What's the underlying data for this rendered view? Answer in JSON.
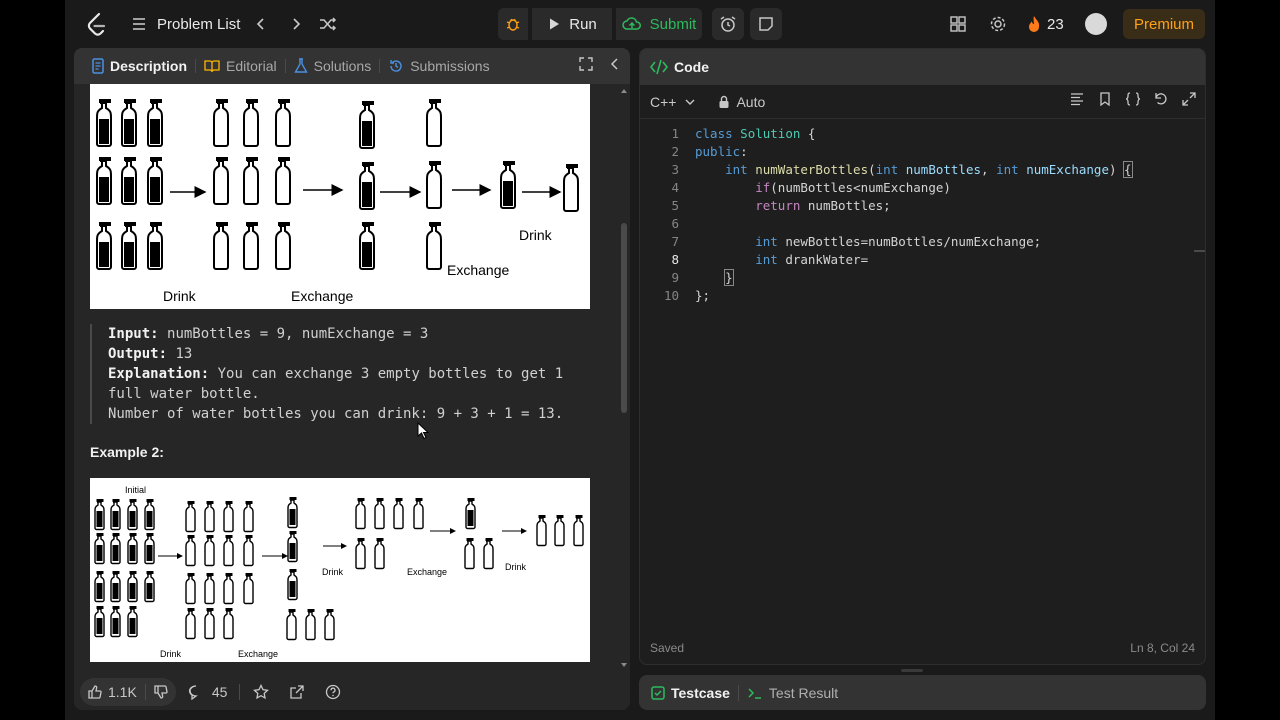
{
  "nav": {
    "problem_list": "Problem List",
    "run": "Run",
    "submit": "Submit",
    "streak": "23",
    "premium": "Premium"
  },
  "tabs": [
    {
      "label": "Description",
      "icon": "description-icon"
    },
    {
      "label": "Editorial",
      "icon": "book-icon"
    },
    {
      "label": "Solutions",
      "icon": "flask-icon"
    },
    {
      "label": "Submissions",
      "icon": "history-icon"
    }
  ],
  "example1": {
    "image_labels": {
      "drink": "Drink",
      "exchange": "Exchange",
      "drink2": "Drink",
      "exchange2": "Exchange"
    },
    "input_label": "Input:",
    "input_value": "numBottles = 9, numExchange = 3",
    "output_label": "Output:",
    "output_value": "13",
    "explanation_label": "Explanation:",
    "explanation_line1": "You can exchange 3 empty bottles to get 1",
    "explanation_line2": "full water bottle.",
    "explanation_line3": "Number of water bottles you can drink: 9 + 3 + 1 = 13."
  },
  "example2": {
    "title": "Example 2:",
    "image_labels": {
      "initial": "Initial",
      "drink": "Drink",
      "exchange": "Exchange",
      "drink2": "Drink",
      "exchange2": "Exchange",
      "drink3": "Drink"
    }
  },
  "bottom": {
    "likes": "1.1K",
    "comments": "45"
  },
  "code": {
    "header": "Code",
    "language": "C++",
    "mode": "Auto",
    "status": "Saved",
    "cursor": "Ln 8, Col 24",
    "line_numbers": [
      "1",
      "2",
      "3",
      "4",
      "5",
      "6",
      "7",
      "8",
      "9",
      "10"
    ]
  },
  "bottom_panel": {
    "testcase": "Testcase",
    "test_result": "Test Result"
  },
  "colors": {
    "accent_orange": "#ffa116",
    "submit_green": "#2cbb5d",
    "panel": "#262626",
    "editor": "#1e1e1e"
  }
}
